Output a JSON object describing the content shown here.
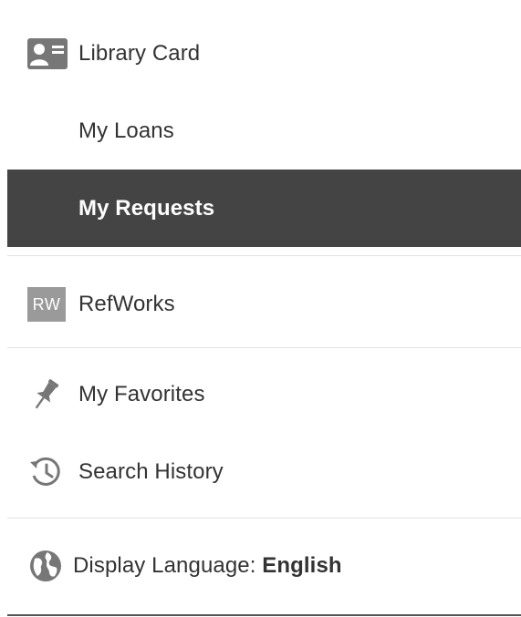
{
  "menu": {
    "library_card": {
      "label": "Library Card",
      "icon": "id-card-icon"
    },
    "my_loans": {
      "label": "My Loans"
    },
    "my_requests": {
      "label": "My Requests",
      "active": true
    },
    "refworks": {
      "label": "RefWorks",
      "badge": "RW",
      "icon": "refworks-icon"
    },
    "my_favorites": {
      "label": "My Favorites",
      "icon": "pin-icon"
    },
    "search_history": {
      "label": "Search History",
      "icon": "history-icon"
    },
    "display_language": {
      "label": "Display Language: ",
      "value": "English",
      "icon": "globe-icon"
    }
  },
  "colors": {
    "active_bg": "#444444",
    "active_text": "#ffffff",
    "text": "#333333",
    "icon": "#777777",
    "divider": "#e3e3e3"
  }
}
